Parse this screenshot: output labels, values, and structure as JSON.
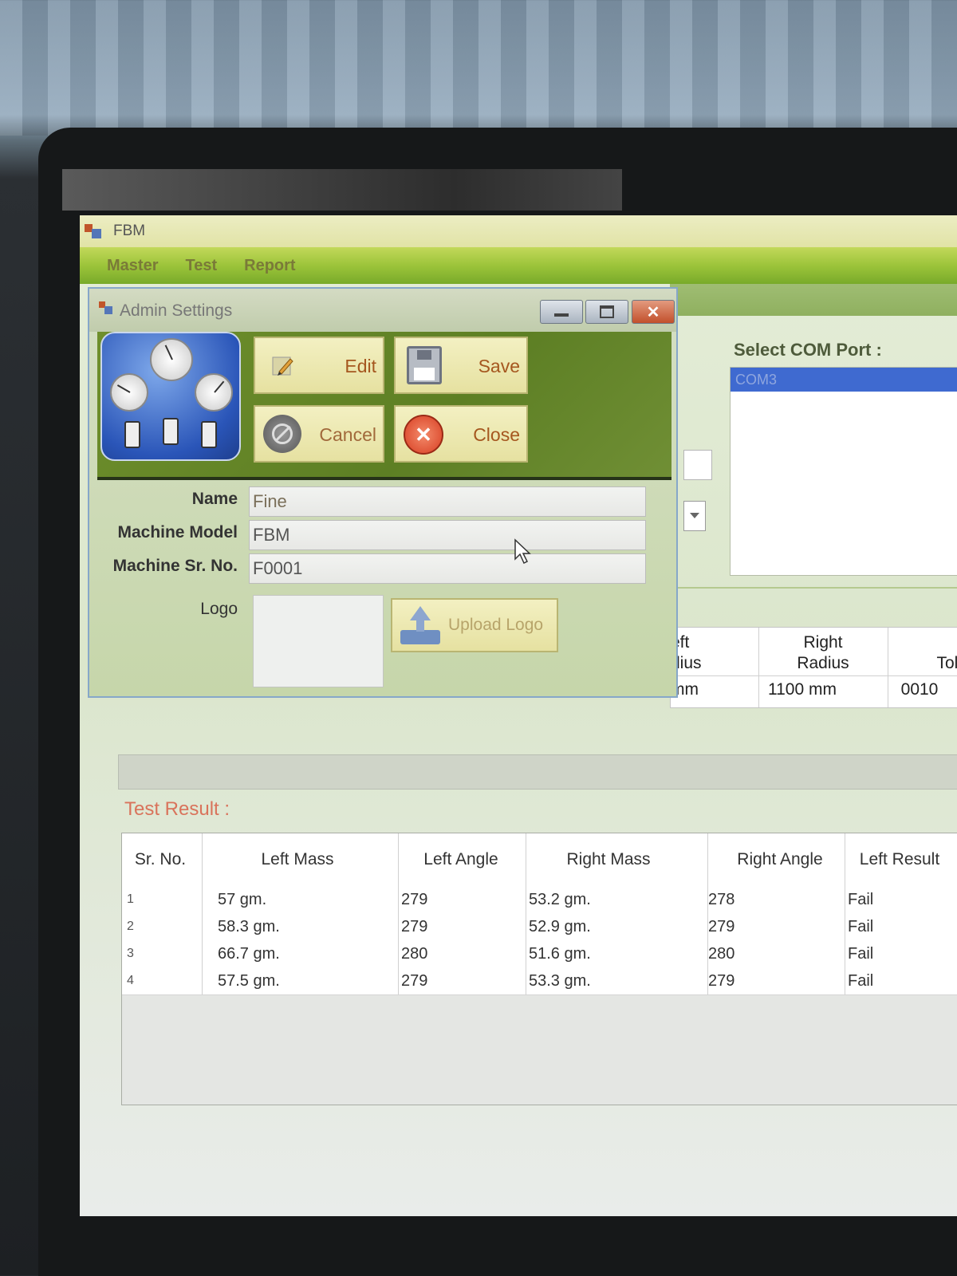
{
  "window": {
    "title": "FBM"
  },
  "menu": [
    "Master",
    "Test",
    "Report"
  ],
  "com_port": {
    "label": "Select COM Port :",
    "options": [
      "COM3"
    ],
    "selected": "COM3"
  },
  "behind_grid": {
    "headers": [
      "eft\ndius",
      "Right\nRadius",
      "L\nTole"
    ],
    "values": [
      "mm",
      "1100 mm",
      "0010"
    ]
  },
  "test_result": {
    "label": "Test Result :",
    "columns": [
      "Sr. No.",
      "Left Mass",
      "Left Angle",
      "Right Mass",
      "Right Angle",
      "Left Result"
    ],
    "rows": [
      [
        "1",
        "57 gm.",
        "279",
        "53.2 gm.",
        "278",
        "Fail"
      ],
      [
        "2",
        "58.3 gm.",
        "279",
        "52.9 gm.",
        "279",
        "Fail"
      ],
      [
        "3",
        "66.7 gm.",
        "280",
        "51.6 gm.",
        "280",
        "Fail"
      ],
      [
        "4",
        "57.5 gm.",
        "279",
        "53.3 gm.",
        "279",
        "Fail"
      ]
    ]
  },
  "admin_dialog": {
    "title": "Admin Settings",
    "buttons": {
      "edit": "Edit",
      "save": "Save",
      "cancel": "Cancel",
      "close": "Close",
      "upload": "Upload Logo"
    },
    "fields": {
      "name": {
        "label": "Name",
        "value": "Fine"
      },
      "model": {
        "label": "Machine Model",
        "value": "FBM"
      },
      "serial": {
        "label": "Machine Sr. No.",
        "value": "F0001"
      },
      "logo": {
        "label": "Logo"
      }
    }
  },
  "colors": {
    "menu_bar": "#9cc43a",
    "dialog_toolbar": "#5d7f24",
    "button_face": "#ede8b2",
    "result_label": "#d9735b",
    "com_selected": "#3f6ad0"
  },
  "icons": [
    "app-icon",
    "gauge-icon",
    "pencil-icon",
    "floppy-icon",
    "cancel-icon",
    "close-icon",
    "upload-icon"
  ]
}
